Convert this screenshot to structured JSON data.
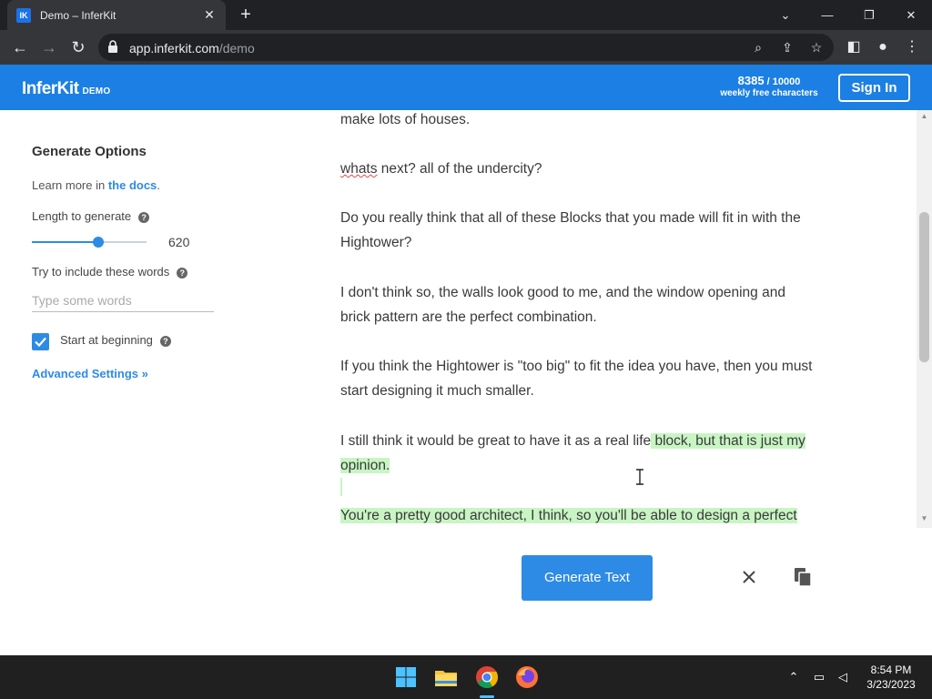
{
  "browser": {
    "tab_title": "Demo – InferKit",
    "tab_favicon_text": "IK",
    "url_host": "app.inferkit.com",
    "url_path": "/demo"
  },
  "header": {
    "brand": "InferKit",
    "brand_sub": "DEMO",
    "quota_used": "8385",
    "quota_sep": " / ",
    "quota_total": "10000",
    "quota_label": "weekly free characters",
    "signin_label": "Sign In",
    "accent_color": "#1c7fe3"
  },
  "sidebar": {
    "title": "Generate Options",
    "docs_prefix": "Learn more in ",
    "docs_link": "the docs",
    "docs_suffix": ".",
    "length_label": "Length to generate",
    "length_value": "620",
    "length_fraction": 0.58,
    "words_label": "Try to include these words",
    "words_placeholder": "Type some words",
    "start_label": "Start at beginning",
    "start_checked": true,
    "advanced_label": "Advanced Settings »"
  },
  "editor": {
    "p1": "make lots of houses.",
    "p2_word": "whats",
    "p2_rest": " next? all of the undercity?",
    "p3": "Do you really think that all of these Blocks that you made will fit in with the Hightower?",
    "p4": "I don't think so, the walls look good to me, and the window opening and brick pattern are the perfect combination.",
    "p5": "If you think the Hightower is \"too big\" to fit the idea you have, then you must start designing it much smaller.",
    "p6_plain": "I still think it would be great to have it as a real life",
    "p6_generated": " block, but that is just my opinion.",
    "p7_generated": "You're a pretty good architect, I think, so you'll be able to design a perfect",
    "generated_color": "#c8f5c3"
  },
  "actions": {
    "generate_label": "Generate Text"
  },
  "taskbar": {
    "time": "8:54 PM",
    "date": "3/23/2023"
  }
}
